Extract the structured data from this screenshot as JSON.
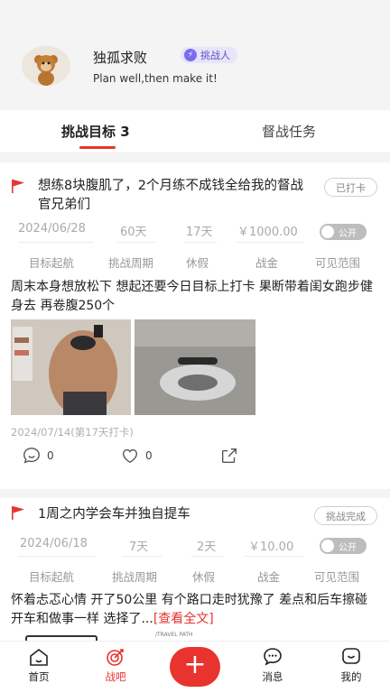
{
  "profile": {
    "username": "独孤求败",
    "badge": "挑战人",
    "motto": "Plan well,then make it!"
  },
  "tabs": [
    {
      "label": "挑战目标 3",
      "active": true
    },
    {
      "label": "督战任务",
      "active": false
    }
  ],
  "field_labels": [
    "目标起航",
    "挑战周期",
    "休假",
    "战金",
    "可见范围"
  ],
  "cards": [
    {
      "title": "想练8块腹肌了，2个月练不成钱全给我的督战官兄弟们",
      "status": "已打卡",
      "start_date": "2024/06/28",
      "period": "60天",
      "leave": "17天",
      "stake": "￥1000.00",
      "visibility": "公开",
      "body": "周末本身想放松下 想起还要今日目标上打卡 果断带着闺女跑步健身去 再卷腹250个",
      "checkin_meta": "2024/07/14(第17天打卡)",
      "comments": "0",
      "likes": "0"
    },
    {
      "title": "1周之内学会车并独自提车",
      "status": "挑战完成",
      "start_date": "2024/06/18",
      "period": "7天",
      "leave": "2天",
      "stake": "￥10.00",
      "visibility": "公开",
      "body": "怀着忐忑心情 开了50公里 有个路口走时犹豫了 差点和后车擦碰 开车和做事一样 选择了...",
      "read_more": "[查看全文]",
      "photo_peek": "/TRAVEL PATH"
    }
  ],
  "nav": [
    {
      "label": "首页",
      "icon": "home-icon"
    },
    {
      "label": "战吧",
      "icon": "target-icon",
      "active": true
    },
    {
      "label": "+",
      "icon": "plus-icon"
    },
    {
      "label": "消息",
      "icon": "message-icon"
    },
    {
      "label": "我的",
      "icon": "profile-icon"
    }
  ],
  "colors": {
    "accent": "#e8332e",
    "badge": "#7a6cf0"
  }
}
